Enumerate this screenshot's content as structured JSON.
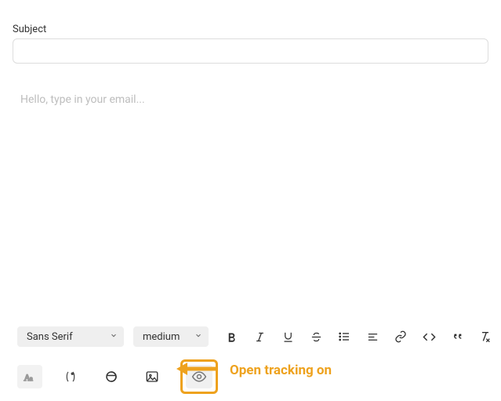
{
  "subject": {
    "label": "Subject",
    "value": ""
  },
  "editor": {
    "placeholder": "Hello, type in your email..."
  },
  "selects": {
    "font_family": "Sans Serif",
    "font_size": "medium"
  },
  "annotation": {
    "label": "Open tracking on"
  }
}
